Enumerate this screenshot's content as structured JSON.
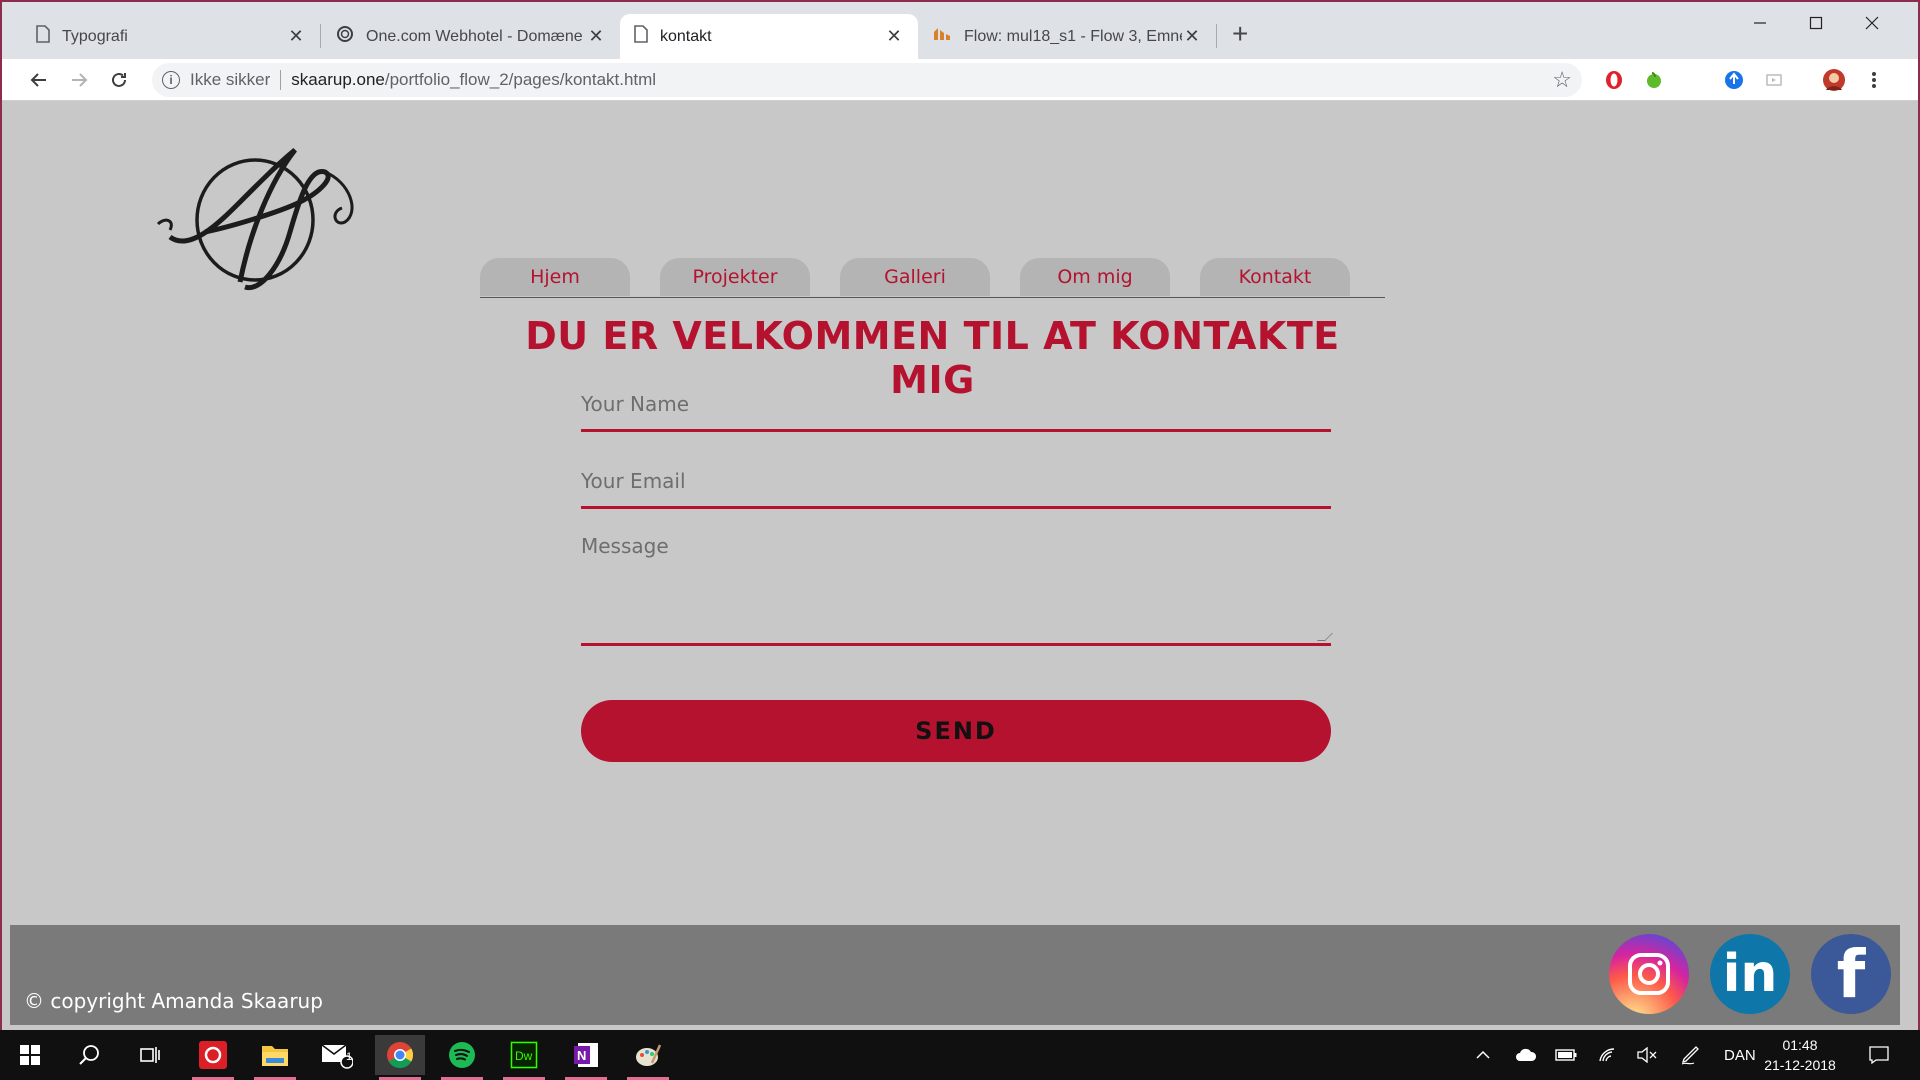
{
  "browser": {
    "tabs": [
      {
        "title": "Typografi",
        "icon": "document-icon",
        "active": false
      },
      {
        "title": "One.com Webhotel - Domæne",
        "icon": "one-com-icon",
        "active": false
      },
      {
        "title": "kontakt",
        "icon": "document-icon",
        "active": true
      },
      {
        "title": "Flow: mul18_s1 - Flow 3, Emne: Fl",
        "icon": "flow-icon",
        "active": false
      }
    ],
    "address": {
      "security_label": "Ikke sikker",
      "host": "skaarup.one",
      "path": "/portfolio_flow_2/pages/kontakt.html"
    }
  },
  "site": {
    "logo_alt": "AS monogram",
    "nav": [
      "Hjem",
      "Projekter",
      "Galleri",
      "Om mig",
      "Kontakt"
    ],
    "headline": "DU ER VELKOMMEN TIL AT KONTAKTE MIG",
    "form": {
      "name_placeholder": "Your Name",
      "email_placeholder": "Your Email",
      "message_placeholder": "Message",
      "send_label": "SEND"
    },
    "footer": {
      "copyright": "© copyright Amanda Skaarup",
      "social": [
        "instagram-icon",
        "linkedin-icon",
        "facebook-icon"
      ],
      "linkedin_text": "in",
      "facebook_text": "f"
    },
    "colors": {
      "accent": "#b5122f",
      "background": "#c8c8c8",
      "footer": "#7a7a7a"
    }
  },
  "taskbar": {
    "language": "DAN",
    "time": "01:48",
    "date": "21-12-2018",
    "mail_badge": "1"
  }
}
